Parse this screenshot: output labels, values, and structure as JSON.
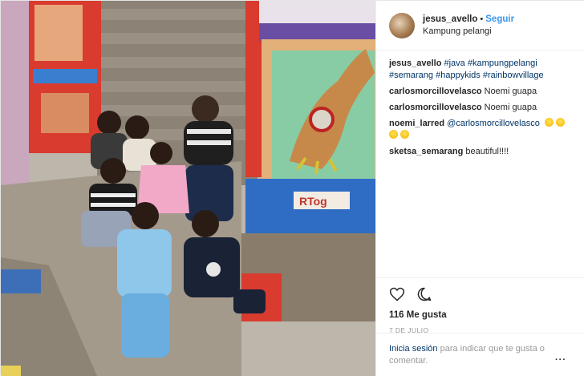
{
  "post": {
    "username": "jesus_avello",
    "separator": "•",
    "follow_label": "Seguir",
    "location": "Kampung pelangi",
    "caption": {
      "user": "jesus_avello",
      "hashtags_line1": [
        "#java",
        "#kampungpelangi"
      ],
      "hashtags_line2": [
        "#semarang",
        "#happykids",
        "#rainbowvillage"
      ]
    },
    "comments": [
      {
        "user": "carlosmorcillovelasco",
        "text": "Noemi guapa"
      },
      {
        "user": "carlosmorcillovelasco",
        "text": "Noemi guapa"
      },
      {
        "user": "noemi_larred",
        "mention": "@carlosmorcillovelasco",
        "emoji_count": 4
      },
      {
        "user": "sketsa_semarang",
        "text": "beautiful!!!!"
      }
    ],
    "like_icon": "heart-icon",
    "comment_icon": "comment-bubble-icon",
    "likes": "116 Me gusta",
    "date": "7 DE JULIO",
    "login_link": "Inicia sesión",
    "login_text": "para indicar que te gusta o comentar.",
    "more_options": "···",
    "photo_sign": "RTog"
  },
  "colors": {
    "link_blue": "#3897f0",
    "hashtag_blue": "#003569",
    "meta_gray": "#999999"
  }
}
